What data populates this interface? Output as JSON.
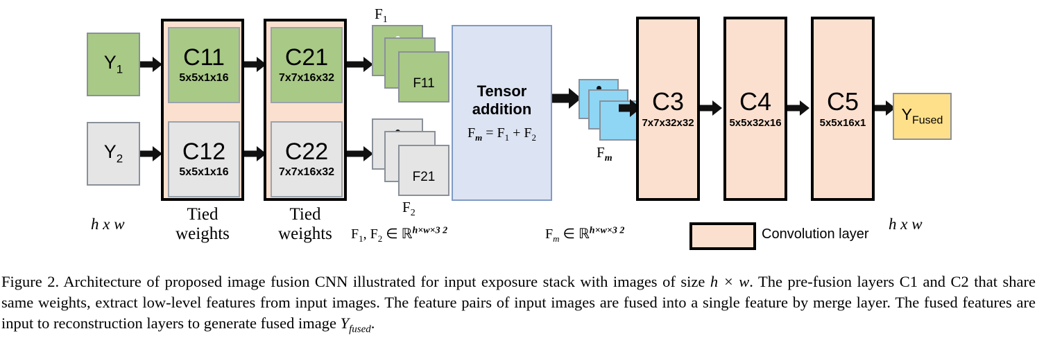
{
  "figure": {
    "inputs": [
      {
        "id": "y1",
        "label": "Y",
        "sub": "1",
        "color": "#a9c987"
      },
      {
        "id": "y2",
        "label": "Y",
        "sub": "2",
        "color": "#e5e5e5"
      }
    ],
    "tied_groups": [
      {
        "id": "c1",
        "label_line1": "Tied",
        "label_line2": "weights",
        "blocks": [
          {
            "name": "C11",
            "kernel": "5x5x1x16",
            "color": "#a9c987"
          },
          {
            "name": "C12",
            "kernel": "5x5x1x16",
            "color": "#e5e5e5"
          }
        ]
      },
      {
        "id": "c2",
        "label_line1": "Tied",
        "label_line2": "weights",
        "blocks": [
          {
            "name": "C21",
            "kernel": "7x7x16x32",
            "color": "#a9c987"
          },
          {
            "name": "C22",
            "kernel": "7x7x16x32",
            "color": "#e5e5e5"
          }
        ]
      }
    ],
    "feature_stacks": [
      {
        "id": "f1",
        "stack_label": "F",
        "stack_sub": "1",
        "card_label": "F11",
        "color": "#a9c987",
        "dot_color": "#ffffff"
      },
      {
        "id": "f2",
        "stack_label": "F",
        "stack_sub": "2",
        "card_label": "F21",
        "color": "#e5e5e5",
        "dot_color": "#111111"
      }
    ],
    "merge": {
      "title_line1": "Tensor",
      "title_line2": "addition",
      "formula_lhs": "F",
      "formula_lhs_sub": "m",
      "formula_eq": " = F",
      "formula_rhs_sub1": "1",
      "formula_plus": " + F",
      "formula_rhs_sub2": "2",
      "color": "#dce3f2"
    },
    "merged_stack": {
      "id": "fm",
      "stack_label": "F",
      "stack_sub": "m",
      "color": "#8fd6f5",
      "dot_color": "#111111"
    },
    "recon_layers": [
      {
        "name": "C3",
        "kernel": "7x7x32x32"
      },
      {
        "name": "C4",
        "kernel": "5x5x32x16"
      },
      {
        "name": "C5",
        "kernel": "5x5x16x1"
      }
    ],
    "output": {
      "label": "Y",
      "sub": "Fused",
      "color": "#ffe08a"
    },
    "size_notes": [
      {
        "id": "left",
        "text": "h x w"
      },
      {
        "id": "right",
        "text": "h x w"
      }
    ],
    "set_notes": [
      {
        "id": "f12",
        "prefix": "F",
        "sub1": "1",
        "mid": ", F",
        "sub2": "2",
        "member": " ∈ ",
        "space": "ℝ",
        "exponent": "h×w×3 2"
      },
      {
        "id": "fm",
        "prefix": "F",
        "sub1": "m",
        "mid": "",
        "sub2": "",
        "member": " ∈ ",
        "space": "ℝ",
        "exponent": "h×w×3 2"
      }
    ],
    "legend": {
      "label": "Convolution layer",
      "swatch_color": "#fbe0cf"
    },
    "colors": {
      "green": "#a9c987",
      "gray": "#e5e5e5",
      "peach": "#fbe0cf",
      "blue": "#dce3f2",
      "cyan": "#8fd6f5",
      "yellow": "#ffe08a",
      "outline": "#000000"
    }
  },
  "caption": {
    "p1": "Figure 2. Architecture of proposed image fusion CNN illustrated for input exposure stack with images of size ",
    "hw": "h × w",
    "p2": ". The pre-fusion layers C1 and C2 that share same weights, extract low-level features from input images. The feature pairs of input images are fused into a single feature by merge layer. The fused features are input to reconstruction layers to generate fused image ",
    "ysym": "Y",
    "ysub": "fused",
    "p3": "."
  }
}
